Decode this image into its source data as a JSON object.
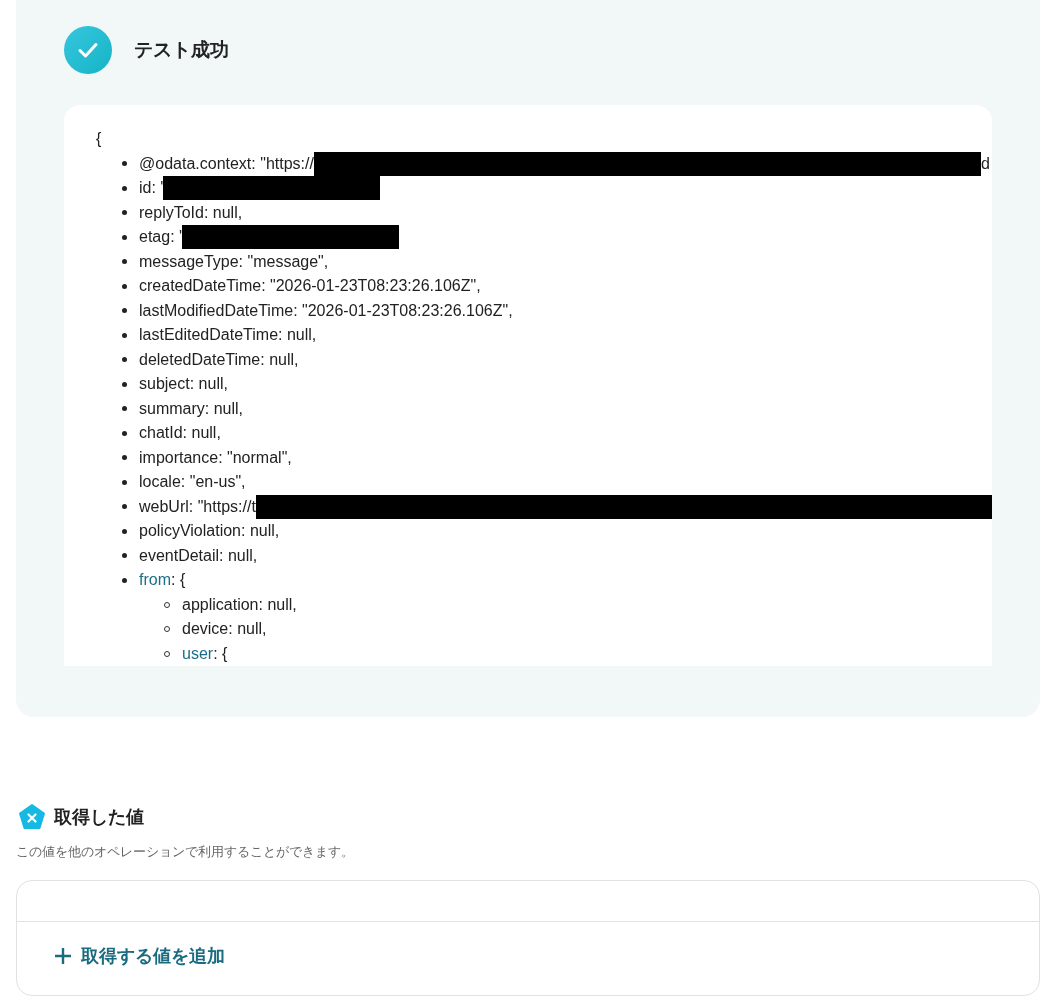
{
  "result": {
    "title": "テスト成功",
    "open": "{",
    "fields": [
      {
        "kind": "value",
        "text": "@odata.context: \"https://",
        "redacted": true,
        "full_width": true,
        "tail": "d"
      },
      {
        "kind": "value",
        "text": "id: '",
        "redacted": true,
        "full_width": false
      },
      {
        "kind": "value",
        "text": "replyToId: null,"
      },
      {
        "kind": "value",
        "text": "etag: '",
        "redacted": true,
        "full_width": false
      },
      {
        "kind": "value",
        "text": "messageType: \"message\","
      },
      {
        "kind": "value",
        "text": "createdDateTime: \"2026-01-23T08:23:26.106Z\","
      },
      {
        "kind": "value",
        "text": "lastModifiedDateTime: \"2026-01-23T08:23:26.106Z\","
      },
      {
        "kind": "value",
        "text": "lastEditedDateTime: null,"
      },
      {
        "kind": "value",
        "text": "deletedDateTime: null,"
      },
      {
        "kind": "value",
        "text": "subject: null,"
      },
      {
        "kind": "value",
        "text": "summary: null,"
      },
      {
        "kind": "value",
        "text": "chatId: null,"
      },
      {
        "kind": "value",
        "text": "importance: \"normal\","
      },
      {
        "kind": "value",
        "text": "locale: \"en-us\","
      },
      {
        "kind": "value",
        "text": "webUrl: \"https://t",
        "redacted": true,
        "full_width": true
      },
      {
        "kind": "value",
        "text": "policyViolation: null,"
      },
      {
        "kind": "value",
        "text": "eventDetail: null,"
      },
      {
        "kind": "object",
        "key": "from",
        "text": ": {",
        "children": [
          {
            "kind": "value",
            "text": "application: null,"
          },
          {
            "kind": "value",
            "text": "device: null,"
          },
          {
            "kind": "object",
            "key": "user",
            "text": ": {"
          }
        ]
      }
    ]
  },
  "values": {
    "title": "取得した値",
    "description": "この値を他のオペレーションで利用することができます。",
    "add_button": "取得する値を追加"
  }
}
